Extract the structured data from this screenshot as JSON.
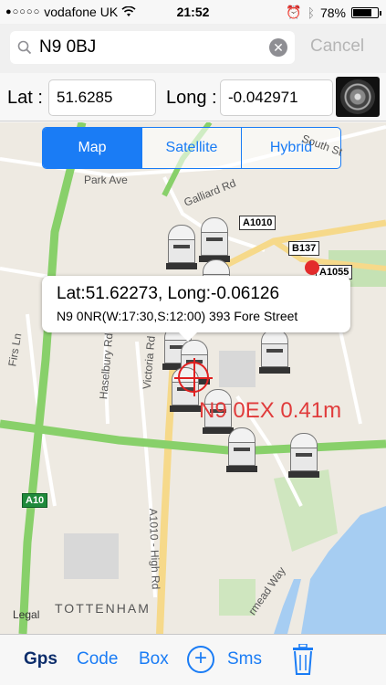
{
  "status_bar": {
    "carrier": "vodafone UK",
    "signal_dots": "●○○○○",
    "time": "21:52",
    "battery": "78%",
    "battery_level": 0.78
  },
  "search": {
    "value": "N9 0BJ",
    "cancel_label": "Cancel"
  },
  "coords": {
    "lat_label": "Lat :",
    "lat_value": "51.6285",
    "long_label": "Long :",
    "long_value": "-0.042971"
  },
  "map": {
    "segments": [
      "Map",
      "Satellite",
      "Hybrid"
    ],
    "selected_segment": "Map",
    "road_labels": {
      "park_ave": "Park Ave",
      "galliard_rd": "Galliard Rd",
      "south_st": "South St",
      "firs_ln": "Firs Ln",
      "haselbury_rd": "Haselbury Rd",
      "victoria_rd": "Victoria Rd",
      "high_rd": "A1010 - High Rd",
      "meads_way": "rmead Way"
    },
    "shields": {
      "a1010": "A1010",
      "b137": "B137",
      "a1055": "A1055",
      "a10": "A10"
    },
    "popup": {
      "line1": "Lat:51.62273, Long:-0.06126",
      "line2": "N9 0NR(W:17:30,S:12:00) 393 Fore Street"
    },
    "distance_label": "N9 0EX 0.41m",
    "legal": "Legal",
    "town": "TOTTENHAM"
  },
  "toolbar": {
    "gps": "Gps",
    "code": "Code",
    "box": "Box",
    "sms": "Sms"
  },
  "colors": {
    "accent": "#1a7cf5",
    "distance_text": "#e03b3b",
    "pin": "#e32b2b"
  }
}
